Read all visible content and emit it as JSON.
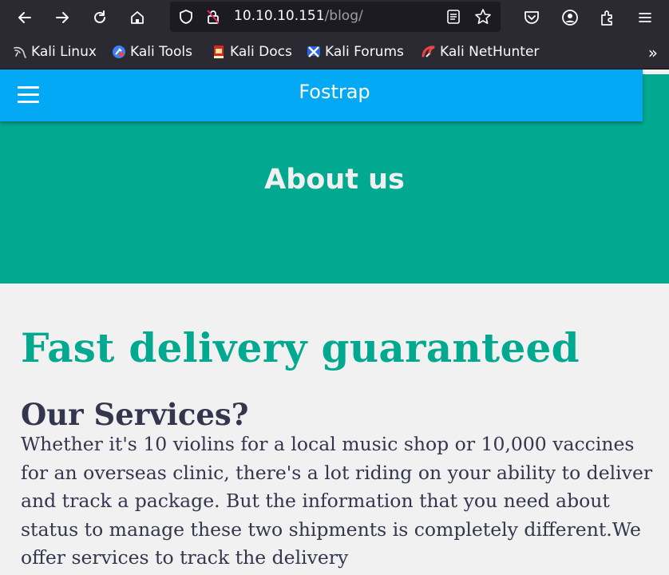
{
  "browser": {
    "url_host": "10.10.10.151",
    "url_path": "/blog/",
    "bookmarks": [
      {
        "label": "Kali Linux",
        "icon": "kali-dragon-icon"
      },
      {
        "label": "Kali Tools",
        "icon": "kali-tools-icon"
      },
      {
        "label": "Kali Docs",
        "icon": "kali-docs-icon"
      },
      {
        "label": "Kali Forums",
        "icon": "kali-forums-icon"
      },
      {
        "label": "Kali NetHunter",
        "icon": "kali-nethunter-icon"
      }
    ],
    "more_label": "»"
  },
  "navbar": {
    "brand": "Fostrap",
    "color": "#03a9f4"
  },
  "hero": {
    "title": "About us",
    "color": "#00a98f"
  },
  "content": {
    "headline": "Fast delivery guaranteed",
    "subheading": "Our Services?",
    "paragraph": "Whether it's 10 violins for a local music shop or 10,000 vaccines for an overseas clinic, there's a lot riding on your ability to deliver and track a package. But the information that you need about status to manage these two shipments is completely different.We offer services to track the delivery"
  }
}
